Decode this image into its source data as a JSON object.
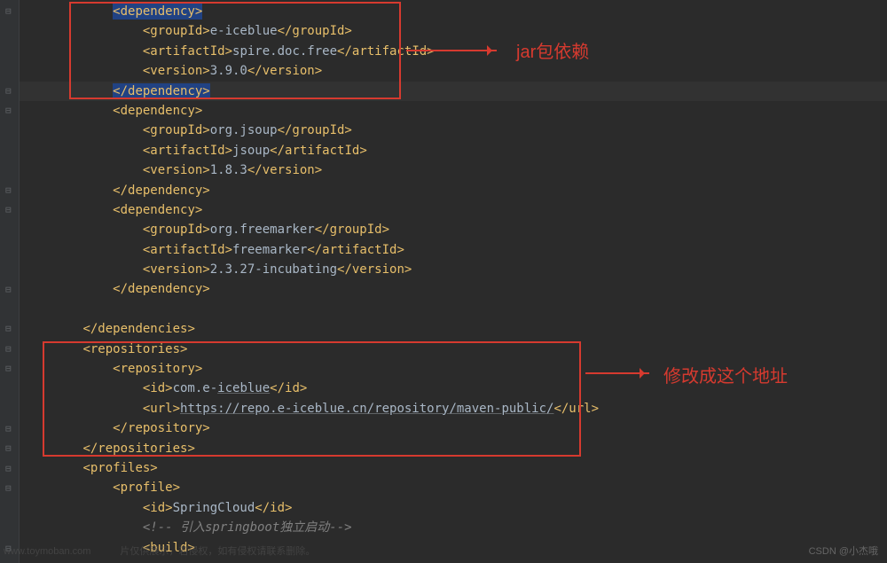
{
  "annotations": {
    "label1": "jar包依赖",
    "label2": "修改成这个地址"
  },
  "watermark_right": "CSDN @小杰哦",
  "watermark_left": "www.toymoban.com　　　片仅供展示，若侵权，如有侵权请联系删除。",
  "lines": {
    "l1_open": "<dependency>",
    "l2_a": "<groupId>",
    "l2_b": "e-iceblue",
    "l2_c": "</groupId>",
    "l3_a": "<artifactId>",
    "l3_b": "spire.doc.free",
    "l3_c": "</artifactId>",
    "l4_a": "<version>",
    "l4_b": "3.9.0",
    "l4_c": "</version>",
    "l5_close": "</dependency>",
    "l6_open": "<dependency>",
    "l7_a": "<groupId>",
    "l7_b": "org.jsoup",
    "l7_c": "</groupId>",
    "l8_a": "<artifactId>",
    "l8_b": "jsoup",
    "l8_c": "</artifactId>",
    "l9_a": "<version>",
    "l9_b": "1.8.3",
    "l9_c": "</version>",
    "l10_close": "</dependency>",
    "l11_open": "<dependency>",
    "l12_a": "<groupId>",
    "l12_b": "org.freemarker",
    "l12_c": "</groupId>",
    "l13_a": "<artifactId>",
    "l13_b": "freemarker",
    "l13_c": "</artifactId>",
    "l14_a": "<version>",
    "l14_b": "2.3.27-incubating",
    "l14_c": "</version>",
    "l15_close": "</dependency>",
    "l17_close": "</dependencies>",
    "l18_open": "<repositories>",
    "l19_open": "<repository>",
    "l20_a": "<id>",
    "l20_b": "com.e-",
    "l20_c": "iceblue",
    "l20_d": "</id>",
    "l21_a": "<url>",
    "l21_b": "https://repo.e-iceblue.cn/repository/maven-public/",
    "l21_c": "</url>",
    "l22_close": "</repository>",
    "l23_close": "</repositories>",
    "l24_open": "<profiles>",
    "l25_open": "<profile>",
    "l26_a": "<id>",
    "l26_b": "SpringCloud",
    "l26_c": "</id>",
    "l27_comment": "<!-- 引入springboot独立启动-->",
    "l28_open": "<build>"
  },
  "indent": {
    "i3": "            ",
    "i4": "                ",
    "i2": "        ",
    "i1": "    "
  }
}
